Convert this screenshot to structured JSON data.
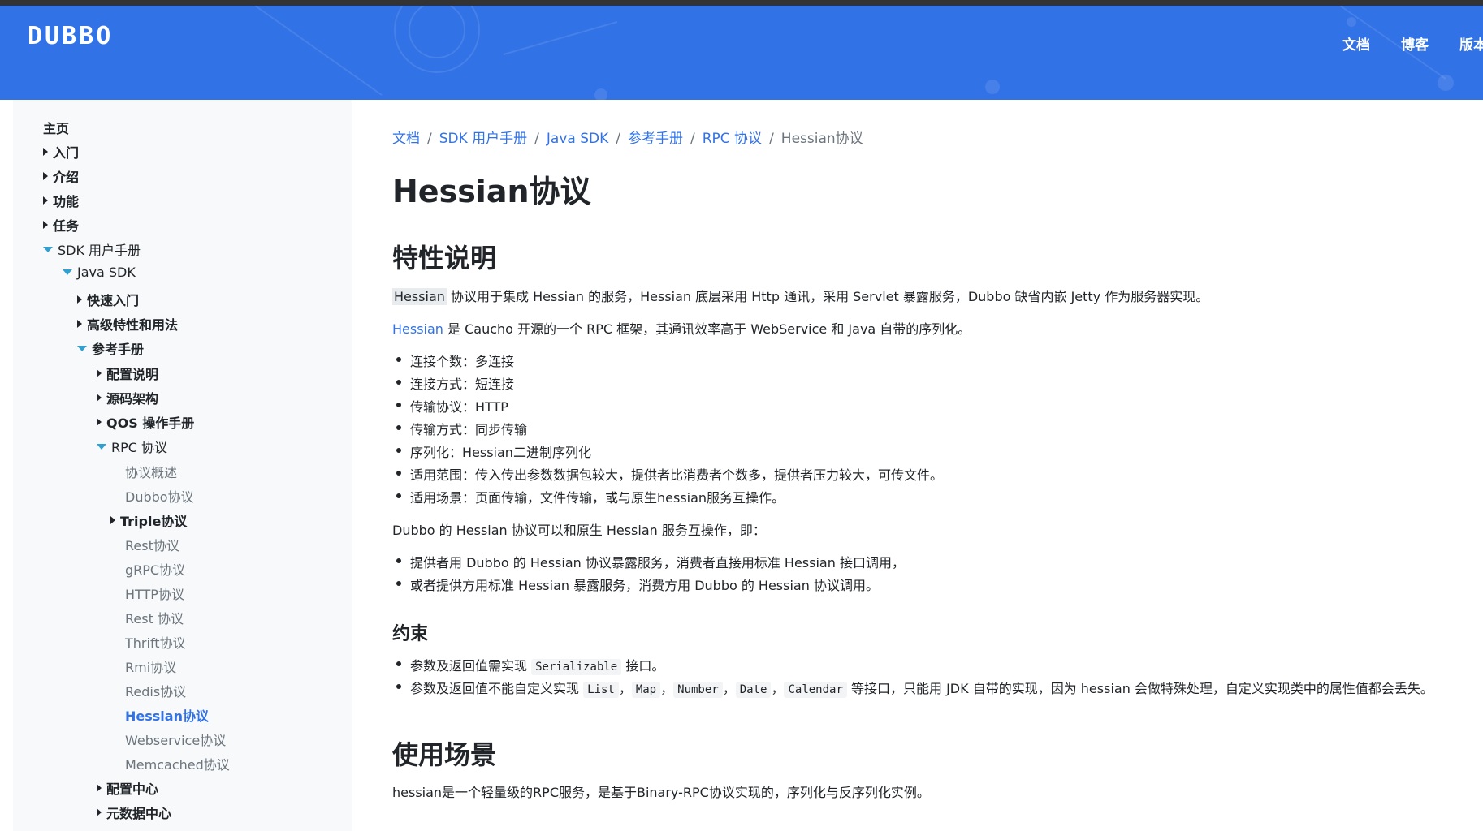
{
  "header": {
    "logo": "DUBBO",
    "nav": [
      {
        "label": "文档"
      },
      {
        "label": "博客"
      },
      {
        "label": "版本"
      }
    ]
  },
  "sidebar": {
    "items": [
      {
        "label": "主页",
        "state": "none",
        "style": "bold"
      },
      {
        "label": "入门",
        "state": "collapsed",
        "style": "bold"
      },
      {
        "label": "介绍",
        "state": "collapsed",
        "style": "bold"
      },
      {
        "label": "功能",
        "state": "collapsed",
        "style": "bold"
      },
      {
        "label": "任务",
        "state": "collapsed",
        "style": "bold"
      },
      {
        "label": "SDK 用户手册",
        "state": "expanded",
        "style": "normal"
      },
      {
        "label": "Java SDK",
        "state": "expanded",
        "style": "normal"
      },
      {
        "label": "快速入门",
        "state": "collapsed",
        "style": "bold"
      },
      {
        "label": "高级特性和用法",
        "state": "collapsed",
        "style": "bold"
      },
      {
        "label": "参考手册",
        "state": "expanded",
        "style": "bold"
      },
      {
        "label": "配置说明",
        "state": "collapsed",
        "style": "bold"
      },
      {
        "label": "源码架构",
        "state": "collapsed",
        "style": "bold"
      },
      {
        "label": "QOS 操作手册",
        "state": "collapsed",
        "style": "bold"
      },
      {
        "label": "RPC 协议",
        "state": "expanded",
        "style": "normal"
      },
      {
        "label": "协议概述",
        "state": "none",
        "style": "leaf"
      },
      {
        "label": "Dubbo协议",
        "state": "none",
        "style": "leaf"
      },
      {
        "label": "Triple协议",
        "state": "collapsed",
        "style": "bold"
      },
      {
        "label": "Rest协议",
        "state": "none",
        "style": "leaf"
      },
      {
        "label": "gRPC协议",
        "state": "none",
        "style": "leaf"
      },
      {
        "label": "HTTP协议",
        "state": "none",
        "style": "leaf"
      },
      {
        "label": "Rest 协议",
        "state": "none",
        "style": "leaf"
      },
      {
        "label": "Thrift协议",
        "state": "none",
        "style": "leaf"
      },
      {
        "label": "Rmi协议",
        "state": "none",
        "style": "leaf"
      },
      {
        "label": "Redis协议",
        "state": "none",
        "style": "leaf"
      },
      {
        "label": "Hessian协议",
        "state": "none",
        "style": "active"
      },
      {
        "label": "Webservice协议",
        "state": "none",
        "style": "leaf"
      },
      {
        "label": "Memcached协议",
        "state": "none",
        "style": "leaf"
      },
      {
        "label": "配置中心",
        "state": "collapsed",
        "style": "bold"
      },
      {
        "label": "元数据中心",
        "state": "collapsed",
        "style": "bold"
      }
    ]
  },
  "breadcrumb": {
    "links": [
      "文档",
      "SDK 用户手册",
      "Java SDK",
      "参考手册",
      "RPC 协议"
    ],
    "current": "Hessian协议",
    "separator": "/"
  },
  "content": {
    "title": "Hessian协议",
    "section1": {
      "heading": "特性说明",
      "p1_code": "Hessian",
      "p1_rest": " 协议用于集成 Hessian 的服务，Hessian 底层采用 Http 通讯，采用 Servlet 暴露服务，Dubbo 缺省内嵌 Jetty 作为服务器实现。",
      "p2_link": "Hessian",
      "p2_rest": " 是 Caucho 开源的一个 RPC 框架，其通讯效率高于 WebService 和 Java 自带的序列化。",
      "features": [
        "连接个数：多连接",
        "连接方式：短连接",
        "传输协议：HTTP",
        "传输方式：同步传输",
        "序列化：Hessian二进制序列化",
        "适用范围：传入传出参数数据包较大，提供者比消费者个数多，提供者压力较大，可传文件。",
        "适用场景：页面传输，文件传输，或与原生hessian服务互操作。"
      ],
      "p3": "Dubbo 的 Hessian 协议可以和原生 Hessian 服务互操作，即：",
      "interop": [
        "提供者用 Dubbo 的 Hessian 协议暴露服务，消费者直接用标准 Hessian 接口调用，",
        "或者提供方用标准 Hessian 暴露服务，消费方用 Dubbo 的 Hessian 协议调用。"
      ]
    },
    "constraints": {
      "heading": "约束",
      "c1_pre": "参数及返回值需实现 ",
      "c1_code": "Serializable",
      "c1_post": " 接口。",
      "c2_pre": "参数及返回值不能自定义实现 ",
      "c2_codes": [
        "List",
        "Map",
        "Number",
        "Date",
        "Calendar"
      ],
      "c2_sep": "，",
      "c2_post": " 等接口，只能用 JDK 自带的实现，因为 hessian 会做特殊处理，自定义实现类中的属性值都会丢失。"
    },
    "usage": {
      "heading": "使用场景",
      "p": "hessian是一个轻量级的RPC服务，是基于Binary-RPC协议实现的，序列化与反序列化实例。"
    }
  },
  "colors": {
    "brand": "#3172e6",
    "link": "#3172e6",
    "expand_arrow": "#30a0d0"
  }
}
